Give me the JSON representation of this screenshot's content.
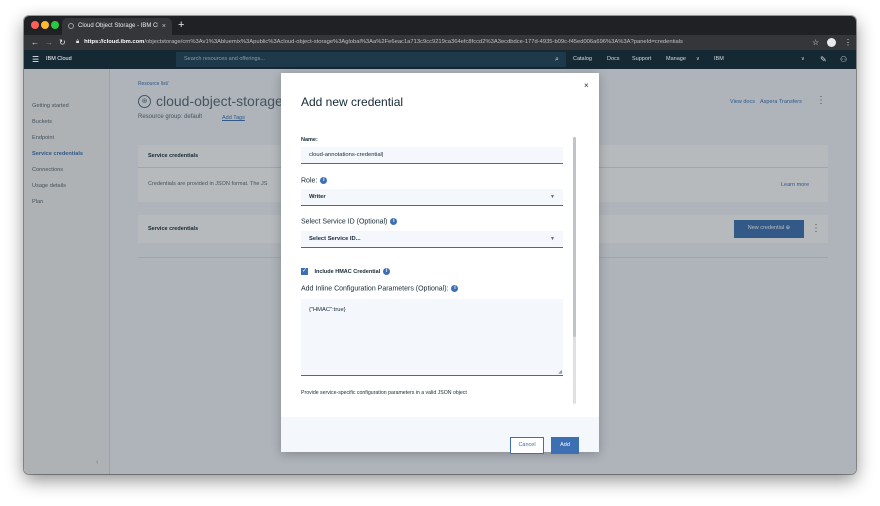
{
  "browser": {
    "tab_title": "Cloud Object Storage - IBM Cl",
    "tab_close": "×",
    "new_tab": "+",
    "url_secure_prefix": "https://",
    "url_host": "cloud.ibm.com",
    "url_path": "/objectstorage/crn%3Av1%3Abluemix%3Apublic%3Acloud-object-storage%3Aglobal%3Aa%2Fe6eac1a713c9cc9219ca364efc8fccd2%3A3ecdbdce-177d-4935-b09c-f45ed006a696%3A%3A?paneId=credentials"
  },
  "appbar": {
    "brand": "IBM Cloud",
    "search_placeholder": "Search resources and offerings...",
    "links": [
      "Catalog",
      "Docs",
      "Support",
      "Manage",
      "IBM"
    ]
  },
  "sidebar": {
    "items": [
      "Getting started",
      "Buckets",
      "Endpoint",
      "Service credentials",
      "Connections",
      "Usage details",
      "Plan"
    ],
    "active_index": 3
  },
  "main": {
    "breadcrumb": "Resource list",
    "breadcrumb_sep": "/",
    "title": "cloud-object-storage-c",
    "resource_group_label": "Resource group: default",
    "add_tags": "Add Tags",
    "view_docs": "View docs",
    "aspera": "Aspera Transfers",
    "service_credentials_heading": "Service credentials",
    "info_text": "Credentials are provided in JSON format. The JS",
    "learn_more": "Learn more",
    "table_heading": "Service credentials",
    "new_credential": "New credential"
  },
  "modal": {
    "title": "Add new credential",
    "close": "×",
    "name_label": "Name:",
    "name_value": "cloud-annotations-credential",
    "role_label": "Role:",
    "role_value": "Writer",
    "service_id_label": "Select Service ID (Optional)",
    "service_id_value": "Select Service ID...",
    "hmac_label": "Include HMAC Credential",
    "hmac_checked": true,
    "inline_label": "Add Inline Configuration Parameters (Optional):",
    "inline_value": "{\"HMAC\":true}",
    "helper_text": "Provide service-specific configuration parameters in a valid JSON object",
    "cancel": "Cancel",
    "add": "Add"
  },
  "colors": {
    "appbar": "#152935",
    "accent": "#3d70b2",
    "text": "#152935"
  }
}
